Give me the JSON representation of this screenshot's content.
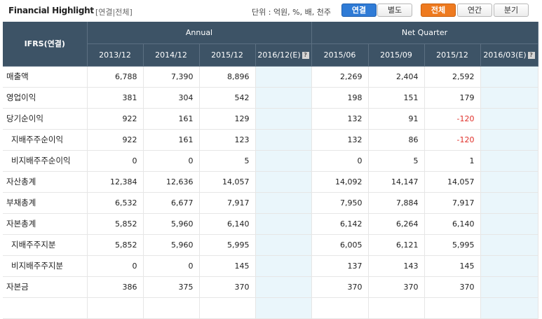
{
  "header": {
    "title": "Financial Highlight",
    "subtitle": "[연결|전체]",
    "unit": "단위 : 억원, %, 배, 천주",
    "consolidation_buttons": [
      {
        "label": "연결",
        "active": true
      },
      {
        "label": "별도",
        "active": false
      }
    ],
    "period_buttons": [
      {
        "label": "전체",
        "active": true
      },
      {
        "label": "연간",
        "active": false
      },
      {
        "label": "분기",
        "active": false
      }
    ],
    "accent_blue": "#2f7bd6",
    "accent_orange": "#ee7a1f",
    "header_bg": "#3d5366",
    "negative_color": "#e0302a"
  },
  "table": {
    "corner": "IFRS(연결)",
    "annual_label": "Annual",
    "quarter_label": "Net Quarter",
    "estimate_icon": "help-icon",
    "estimate_icon_glyph": "?",
    "annual_periods": [
      "2013/12",
      "2014/12",
      "2015/12",
      "2016/12(E)"
    ],
    "quarter_periods": [
      "2015/06",
      "2015/09",
      "2015/12",
      "2016/03(E)"
    ],
    "rows": [
      {
        "label": "매출액",
        "sub": false,
        "annual": [
          "6,788",
          "7,390",
          "8,896",
          ""
        ],
        "quarter": [
          "2,269",
          "2,404",
          "2,592",
          ""
        ]
      },
      {
        "label": "영업이익",
        "sub": false,
        "annual": [
          "381",
          "304",
          "542",
          ""
        ],
        "quarter": [
          "198",
          "151",
          "179",
          ""
        ]
      },
      {
        "label": "당기순이익",
        "sub": false,
        "annual": [
          "922",
          "161",
          "129",
          ""
        ],
        "quarter": [
          "132",
          "91",
          "-120",
          ""
        ]
      },
      {
        "label": "지배주주순이익",
        "sub": true,
        "annual": [
          "922",
          "161",
          "123",
          ""
        ],
        "quarter": [
          "132",
          "86",
          "-120",
          ""
        ]
      },
      {
        "label": "비지배주주순이익",
        "sub": true,
        "annual": [
          "0",
          "0",
          "5",
          ""
        ],
        "quarter": [
          "0",
          "5",
          "1",
          ""
        ]
      },
      {
        "label": "자산총계",
        "sub": false,
        "annual": [
          "12,384",
          "12,636",
          "14,057",
          ""
        ],
        "quarter": [
          "14,092",
          "14,147",
          "14,057",
          ""
        ]
      },
      {
        "label": "부채총계",
        "sub": false,
        "annual": [
          "6,532",
          "6,677",
          "7,917",
          ""
        ],
        "quarter": [
          "7,950",
          "7,884",
          "7,917",
          ""
        ]
      },
      {
        "label": "자본총계",
        "sub": false,
        "annual": [
          "5,852",
          "5,960",
          "6,140",
          ""
        ],
        "quarter": [
          "6,142",
          "6,264",
          "6,140",
          ""
        ]
      },
      {
        "label": "지배주주지분",
        "sub": true,
        "annual": [
          "5,852",
          "5,960",
          "5,995",
          ""
        ],
        "quarter": [
          "6,005",
          "6,121",
          "5,995",
          ""
        ]
      },
      {
        "label": "비지배주주지분",
        "sub": true,
        "annual": [
          "0",
          "0",
          "145",
          ""
        ],
        "quarter": [
          "137",
          "143",
          "145",
          ""
        ]
      },
      {
        "label": "자본금",
        "sub": false,
        "annual": [
          "386",
          "375",
          "370",
          ""
        ],
        "quarter": [
          "370",
          "370",
          "370",
          ""
        ]
      },
      {
        "label": "",
        "sub": false,
        "annual": [
          "",
          "",
          "",
          ""
        ],
        "quarter": [
          "",
          "",
          "",
          ""
        ]
      }
    ]
  }
}
